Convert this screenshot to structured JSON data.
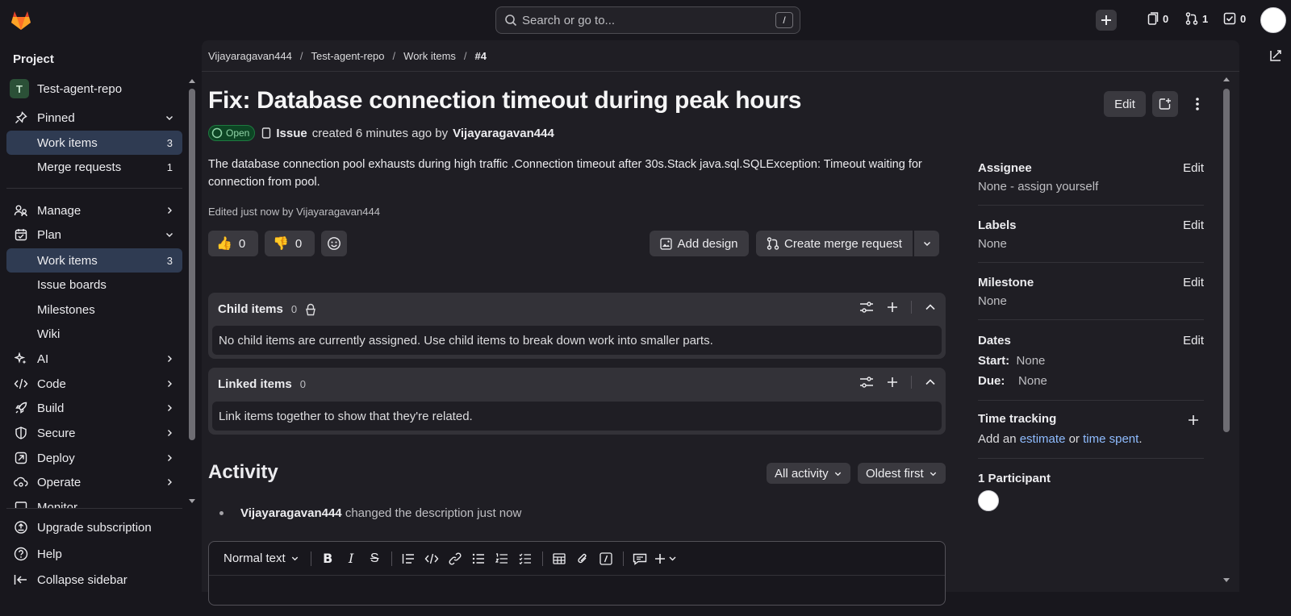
{
  "topbar": {
    "search_placeholder": "Search or go to...",
    "search_shortcut": "/",
    "issues_count": "0",
    "merge_requests_count": "1",
    "todos_count": "0"
  },
  "sidebar": {
    "heading": "Project",
    "project_initial": "T",
    "project_name": "Test-agent-repo",
    "pinned": {
      "label": "Pinned",
      "items": [
        {
          "label": "Work items",
          "count": "3"
        },
        {
          "label": "Merge requests",
          "count": "1"
        }
      ]
    },
    "sections": [
      {
        "label": "Manage"
      },
      {
        "label": "Plan"
      },
      {
        "label": "AI"
      },
      {
        "label": "Code"
      },
      {
        "label": "Build"
      },
      {
        "label": "Secure"
      },
      {
        "label": "Deploy"
      },
      {
        "label": "Operate"
      },
      {
        "label": "Monitor"
      }
    ],
    "plan_items": [
      {
        "label": "Work items",
        "count": "3"
      },
      {
        "label": "Issue boards"
      },
      {
        "label": "Milestones"
      },
      {
        "label": "Wiki"
      }
    ],
    "footer": {
      "upgrade": "Upgrade subscription",
      "help": "Help",
      "collapse": "Collapse sidebar"
    }
  },
  "breadcrumb": [
    "Vijayaragavan444",
    "Test-agent-repo",
    "Work items",
    "#4"
  ],
  "issue": {
    "title": "Fix: Database connection timeout during peak hours",
    "edit_label": "Edit",
    "status": "Open",
    "type": "Issue",
    "created_text": "created 6 minutes ago by",
    "author": "Vijayaragavan444",
    "description": "The database connection pool exhausts during high traffic .Connection timeout after 30s.Stack java.sql.SQLException: Timeout waiting for connection from pool.",
    "edited_note": "Edited just now by Vijayaragavan444",
    "thumbs_up": "0",
    "thumbs_down": "0",
    "add_design": "Add design",
    "create_mr": "Create merge request"
  },
  "child_items": {
    "title": "Child items",
    "count": "0",
    "empty": "No child items are currently assigned. Use child items to break down work into smaller parts."
  },
  "linked_items": {
    "title": "Linked items",
    "count": "0",
    "empty": "Link items together to show that they're related."
  },
  "activity": {
    "title": "Activity",
    "filter": "All activity",
    "sort": "Oldest first",
    "item_user": "Vijayaragavan444",
    "item_text": "changed the description just now"
  },
  "editor": {
    "text_style": "Normal text"
  },
  "side": {
    "edit": "Edit",
    "assignee": {
      "title": "Assignee",
      "value": "None - assign yourself"
    },
    "labels": {
      "title": "Labels",
      "value": "None"
    },
    "milestone": {
      "title": "Milestone",
      "value": "None"
    },
    "dates": {
      "title": "Dates",
      "start_label": "Start:",
      "start": "None",
      "due_label": "Due:",
      "due": "None"
    },
    "time_tracking": {
      "title": "Time tracking",
      "prefix": "Add an",
      "estimate": "estimate",
      "or": "or",
      "spent": "time spent",
      "suffix": "."
    },
    "participants": {
      "title": "1 Participant"
    }
  },
  "colors": {
    "background": "#18171d",
    "panel": "#1f1e24",
    "active_nav": "#2f3b52",
    "open_badge": "#0d4524",
    "link": "#8fbcff"
  }
}
